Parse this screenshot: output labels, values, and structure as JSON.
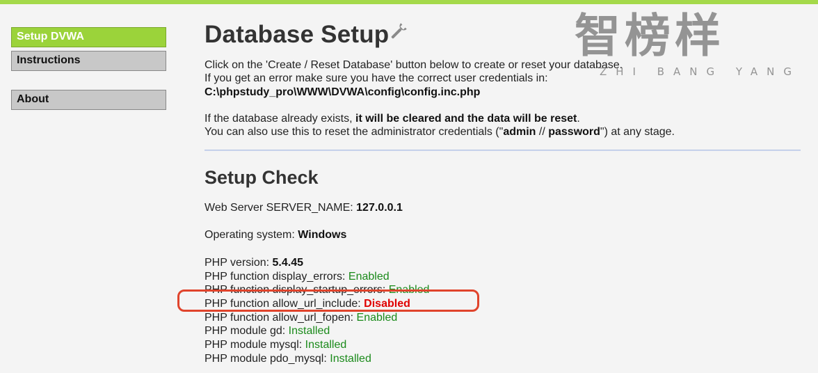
{
  "menu": {
    "items": [
      {
        "label": "Setup DVWA"
      },
      {
        "label": "Instructions"
      },
      {
        "label": "About"
      }
    ]
  },
  "page": {
    "title": "Database Setup",
    "intro_line1": "Click on the 'Create / Reset Database' button below to create or reset your database.",
    "intro_line2": "If you get an error make sure you have the correct user credentials in:",
    "config_path": "C:\\phpstudy_pro\\WWW\\DVWA\\config\\config.inc.php",
    "warn_prefix": "If the database already exists, ",
    "warn_bold": "it will be cleared and the data will be reset",
    "warn_suffix": ".",
    "reset_prefix": "You can also use this to reset the administrator credentials (\"",
    "reset_user": "admin",
    "reset_sep": " // ",
    "reset_pass": "password",
    "reset_suffix": "\") at any stage."
  },
  "setup_check": {
    "heading": "Setup Check",
    "server_name_label": "Web Server SERVER_NAME: ",
    "server_name_value": "127.0.0.1",
    "os_label": "Operating system: ",
    "os_value": "Windows",
    "php_version_label": "PHP version: ",
    "php_version_value": "5.4.45",
    "checks": [
      {
        "label": "PHP function display_errors: ",
        "value": "Enabled"
      },
      {
        "label": "PHP function display_startup_errors: ",
        "value": "Enabled"
      },
      {
        "label": "PHP function allow_url_include: ",
        "value": "Disabled"
      },
      {
        "label": "PHP function allow_url_fopen: ",
        "value": "Enabled"
      },
      {
        "label": "PHP module gd: ",
        "value": "Installed"
      },
      {
        "label": "PHP module mysql: ",
        "value": "Installed"
      },
      {
        "label": "PHP module pdo_mysql: ",
        "value": "Installed"
      }
    ]
  },
  "watermark": {
    "chinese": "智榜样",
    "pinyin": "ZHI BANG YANG"
  },
  "icons": {
    "title_icon": "wrench-icon"
  },
  "colors": {
    "accent": "#9bd33a",
    "ok": "#1a8a1a",
    "bad": "#e00000",
    "annotation": "#e0442c"
  }
}
